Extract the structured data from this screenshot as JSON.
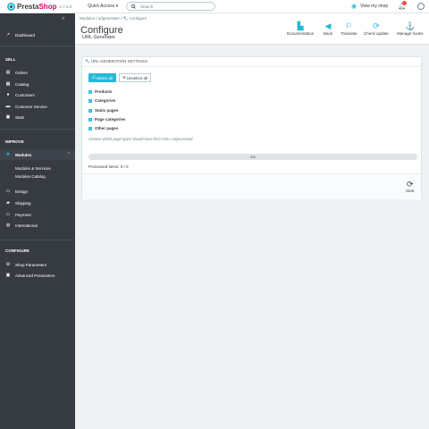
{
  "topbar": {
    "brand_prefix": "Presta",
    "brand_suffix": "Shop",
    "version": "1.7.4.2",
    "quick_access": "Quick Access ▾",
    "search_placeholder": "Search",
    "view_shop": "View my shop"
  },
  "sidebar": {
    "dashboard": "Dashboard",
    "sell_title": "SELL",
    "orders": "Orders",
    "catalog": "Catalog",
    "customers": "Customers",
    "customer_service": "Customer Service",
    "stats": "Stats",
    "improve_title": "IMPROVE",
    "modules": "Modules",
    "modules_services": "Modules & Services",
    "modules_catalog": "Modules Catalog",
    "design": "Design",
    "shipping": "Shipping",
    "payment": "Payment",
    "international": "International",
    "configure_title": "CONFIGURE",
    "shop_parameters": "Shop Parameters",
    "advanced_parameters": "Advanced Parameters"
  },
  "header": {
    "breadcrumb": "Modules  /  urlgenerator  /  🔧 Configure",
    "title": "Configure",
    "subtitle": "URL Generator",
    "toolbar": {
      "documentation": "Documentation",
      "back": "Back",
      "translate": "Translate",
      "check_update": "Check update",
      "manage_hooks": "Manage hooks"
    }
  },
  "panel": {
    "title": "🔧 URL GENERATION SETTINGS",
    "select_all": "Select all",
    "unselect_all": "Unselect all",
    "options": [
      "Products",
      "Categories",
      "Static pages",
      "Page categories",
      "Other pages"
    ],
    "help": "Choose which page types should have their URLs regenerated.",
    "progress": 0,
    "progress_label": "0%",
    "processed": "Processed items: 0 / 0",
    "start": "Start"
  },
  "colors": {
    "accent": "#25b9d7",
    "sidebar": "#363a41",
    "brand_pink": "#df0067"
  }
}
